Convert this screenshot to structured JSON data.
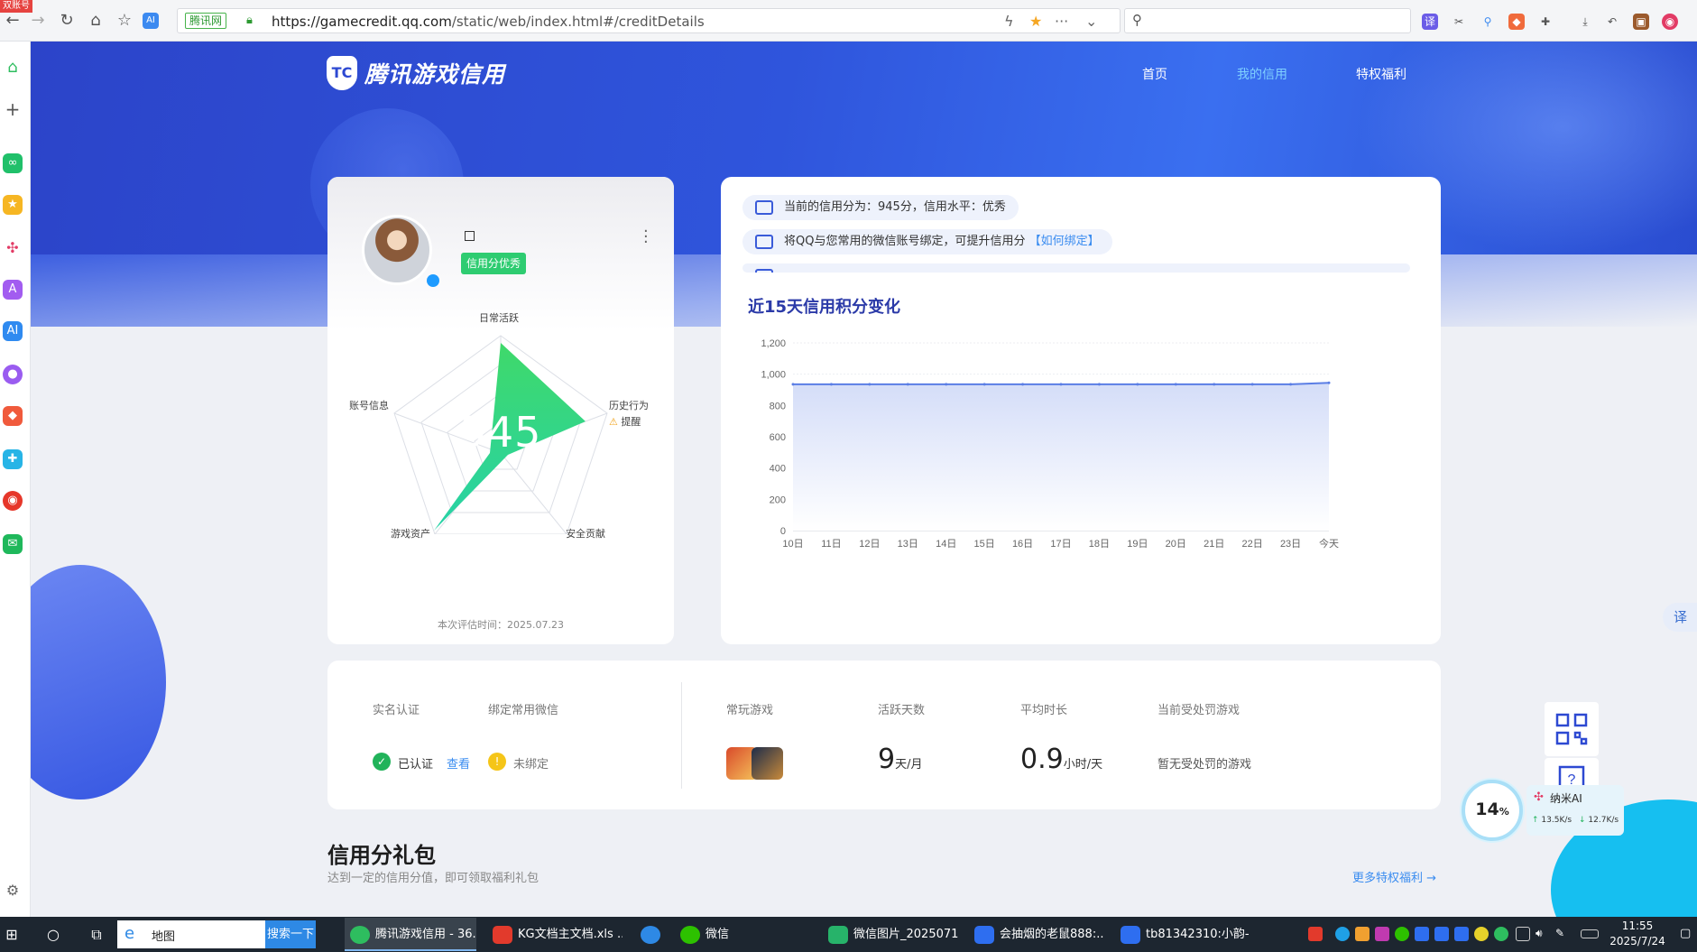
{
  "browser": {
    "badge": "双账号",
    "site_tag": "腾讯网",
    "url_host": "https://gamecredit.qq.com",
    "url_path": "/static/web/index.html#/creditDetails"
  },
  "nav": {
    "logo_text": "腾讯游戏信用",
    "items": [
      "首页",
      "我的信用",
      "特权福利"
    ],
    "active_index": 1
  },
  "profile": {
    "badge": "信用分优秀",
    "score": "945",
    "radar_labels": {
      "top": "日常活跃",
      "right": "历史行为",
      "bottom_right": "安全贡献",
      "bottom_left": "游戏资产",
      "left": "账号信息"
    },
    "warning": "提醒",
    "eval_time": "本次评估时间：2025.07.23"
  },
  "notices": [
    {
      "text": "当前的信用分为：945分，信用水平：优秀",
      "link": ""
    },
    {
      "text": "将QQ与您常用的微信账号绑定，可提升信用分",
      "link": "【如何绑定】"
    }
  ],
  "chart_title": "近15天信用积分变化",
  "chart_data": {
    "type": "area",
    "x": [
      "10日",
      "11日",
      "12日",
      "13日",
      "14日",
      "15日",
      "16日",
      "17日",
      "18日",
      "19日",
      "20日",
      "21日",
      "22日",
      "23日",
      "今天"
    ],
    "series": [
      {
        "values": [
          935,
          935,
          935,
          935,
          935,
          935,
          935,
          935,
          935,
          935,
          935,
          935,
          935,
          935,
          945
        ]
      }
    ],
    "ylim": [
      0,
      1200
    ],
    "yticks": [
      "0",
      "200",
      "400",
      "600",
      "800",
      "1,000",
      "1,200"
    ],
    "grid": true,
    "color": "#5b7ee5"
  },
  "stats": {
    "headers": [
      "实名认证",
      "绑定常用微信",
      "常玩游戏",
      "活跃天数",
      "平均时长",
      "当前受处罚游戏"
    ],
    "real_name_status": "已认证",
    "real_name_link": "查看",
    "wechat_status": "未绑定",
    "active_days": "9",
    "active_days_unit": "天/月",
    "avg_duration": "0.9",
    "avg_duration_unit": "小时/天",
    "punished": "暂无受处罚的游戏"
  },
  "gift": {
    "title": "信用分礼包",
    "subtitle": "达到一定的信用分值，即可领取福利礼包",
    "more": "更多特权福利 →"
  },
  "float": {
    "translate": "译",
    "nami_percent": "14",
    "nami_name": "纳米AI",
    "nami_up": "13.5K/s",
    "nami_down": "12.7K/s"
  },
  "taskbar": {
    "search_text": "地图",
    "search_btn": "搜索一下",
    "apps": [
      "腾讯游戏信用 - 36...",
      "KG文档主文档.xls ...",
      "微信",
      "微信图片_2025071...",
      "会抽烟的老鼠888:...",
      "tb81342310:小韵-..."
    ],
    "time": "11:55",
    "date": "2025/7/24"
  }
}
